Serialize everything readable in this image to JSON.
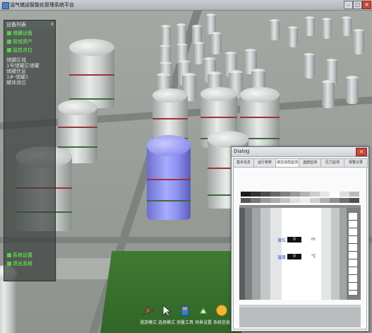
{
  "window": {
    "title": "油气储运智能化管理系统平台",
    "minimize": "–",
    "maximize": "□",
    "close": "✕"
  },
  "left_panel": {
    "title": "设备列表",
    "close": "x",
    "items": [
      {
        "label": "储罐设备"
      },
      {
        "label": "管线资产"
      },
      {
        "label": "监控点位"
      }
    ],
    "tree_header": "储罐区域",
    "tree": [
      "1号储罐区储罐",
      "  储罐信息",
      "  1#-储罐1",
      "    罐体液位"
    ],
    "bottom_items": [
      {
        "label": "系统设置"
      },
      {
        "label": "退出系统"
      }
    ]
  },
  "toolbar": [
    {
      "label": "漫游模式",
      "icon": "roam-icon"
    },
    {
      "label": "选择模式",
      "icon": "cursor-icon"
    },
    {
      "label": "测量工具",
      "icon": "measure-icon"
    },
    {
      "label": "场景设置",
      "icon": "settings-icon"
    },
    {
      "label": "系统信息",
      "icon": "info-icon"
    }
  ],
  "dialog": {
    "title": "Dialog",
    "close": "✕",
    "tabs": [
      {
        "label": "基本信息"
      },
      {
        "label": "运行参数"
      },
      {
        "label": "液位动态监测",
        "active": true
      },
      {
        "label": "温度监测"
      },
      {
        "label": "压力监测"
      },
      {
        "label": "报警记录"
      }
    ],
    "readouts": [
      {
        "label": "液位",
        "value": "0",
        "unit": "m"
      },
      {
        "label": "温度",
        "value": "0",
        "unit": "℃"
      }
    ]
  },
  "colors": {
    "highlight_tank": "#9a9df5",
    "panel_text": "#64ff4a",
    "readout_label": "#1a3fbf"
  }
}
